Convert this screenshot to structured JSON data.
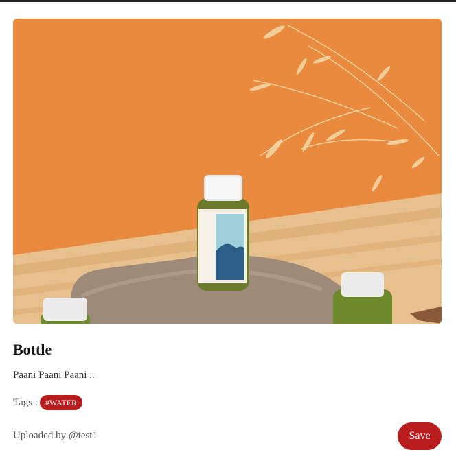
{
  "post": {
    "image_description": "photo-of-juice-bottle-on-rock",
    "title": "Bottle",
    "description": "Paani Paani Paani ..",
    "tags_label": "Tags :",
    "tags": [
      "#WATER"
    ],
    "uploaded_by": "Uploaded by @test1",
    "save_label": "Save"
  },
  "colors": {
    "accent": "#b91c1c",
    "topbar": "#222222"
  }
}
